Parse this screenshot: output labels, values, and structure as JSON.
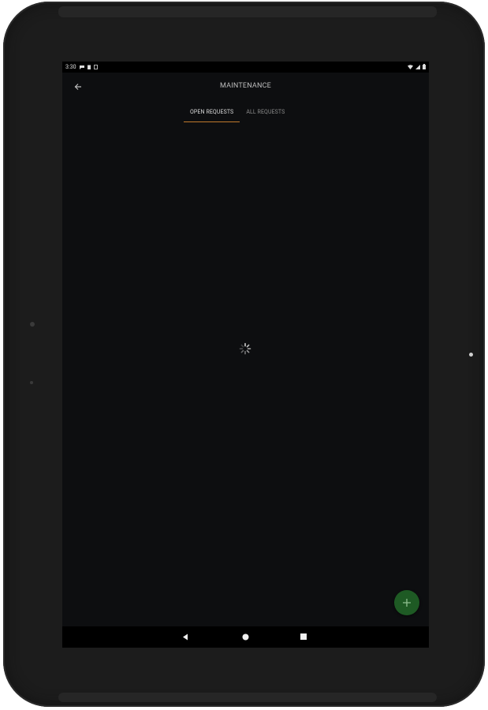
{
  "status_bar": {
    "time": "3:30"
  },
  "app_bar": {
    "title": "MAINTENANCE"
  },
  "tabs": [
    {
      "label": "OPEN REQUESTS",
      "active": true
    },
    {
      "label": "ALL REQUESTS",
      "active": false
    }
  ],
  "colors": {
    "background": "#0d0e10",
    "tab_indicator": "#c07a2c",
    "fab": "#1e5a24"
  },
  "icons": {
    "back": "arrow-left-icon",
    "fab": "plus-icon",
    "loading": "spinner-icon",
    "nav_back": "triangle-back-icon",
    "nav_home": "circle-home-icon",
    "nav_recents": "square-recents-icon"
  }
}
